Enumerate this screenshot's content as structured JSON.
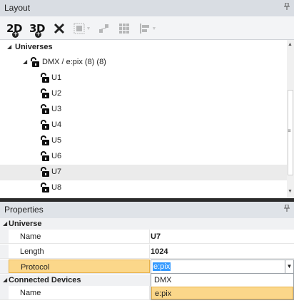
{
  "layout_panel": {
    "title": "Layout",
    "pin": "҂",
    "toolbar": {
      "btn_2d": "2D",
      "btn_3d": "3D"
    },
    "tree": {
      "root_label": "Universes",
      "group_label": "DMX / e:pix (8) (8)",
      "universes": [
        "U1",
        "U2",
        "U3",
        "U4",
        "U5",
        "U6",
        "U7",
        "U8"
      ],
      "selected": "U7"
    }
  },
  "properties_panel": {
    "title": "Properties",
    "pin": "҂",
    "categories": {
      "universe": {
        "label": "Universe",
        "name_label": "Name",
        "name_value": "U7",
        "length_label": "Length",
        "length_value": "1024",
        "protocol_label": "Protocol",
        "protocol_value": "e:pix"
      },
      "connected_devices": {
        "label": "Connected Devices",
        "name_label": "Name"
      }
    },
    "protocol_dropdown": {
      "options": [
        "DMX",
        "e:pix"
      ],
      "highlighted": "e:pix"
    }
  },
  "colors": {
    "accent_highlight": "#fbd78a",
    "selection_blue": "#3399ff",
    "title_bar": "#d9dde3"
  }
}
